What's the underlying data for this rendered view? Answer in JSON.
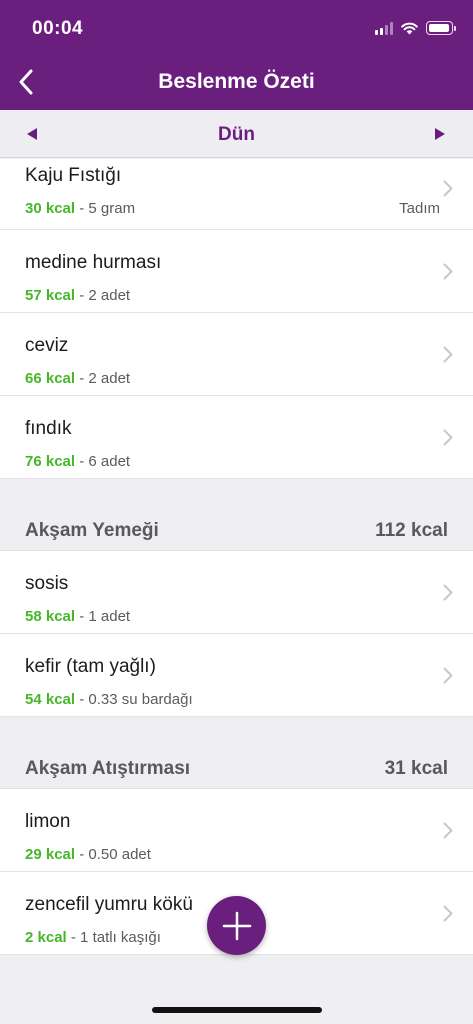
{
  "status_bar": {
    "time": "00:04"
  },
  "nav": {
    "title": "Beslenme Özeti"
  },
  "date_nav": {
    "label": "Dün"
  },
  "sections": [
    {
      "items": [
        {
          "name": "Kaju Fıstığı",
          "kcal": "30 kcal",
          "amount": "- 5 gram",
          "tag": "Tadım"
        },
        {
          "name": "medine hurması",
          "kcal": "57 kcal",
          "amount": "- 2 adet"
        },
        {
          "name": "ceviz",
          "kcal": "66 kcal",
          "amount": "- 2 adet"
        },
        {
          "name": "fındık",
          "kcal": "76 kcal",
          "amount": "- 6 adet"
        }
      ]
    },
    {
      "title": "Akşam Yemeği",
      "total": "112 kcal",
      "items": [
        {
          "name": "sosis",
          "kcal": "58 kcal",
          "amount": "- 1 adet"
        },
        {
          "name": "kefir (tam yağlı)",
          "kcal": "54 kcal",
          "amount": "- 0.33 su bardağı"
        }
      ]
    },
    {
      "title": "Akşam Atıştırması",
      "total": "31 kcal",
      "items": [
        {
          "name": "limon",
          "kcal": "29 kcal",
          "amount": "- 0.50 adet"
        },
        {
          "name": "zencefil yumru kökü",
          "kcal": "2 kcal",
          "amount": "- 1 tatlı kaşığı"
        }
      ]
    }
  ],
  "colors": {
    "brand": "#6a1f7e",
    "kcal": "#47b62a"
  },
  "icons": {
    "back": "chevron-left-icon",
    "prev": "triangle-left-icon",
    "next": "triangle-right-icon",
    "row": "chevron-right-icon",
    "add": "plus-icon"
  }
}
